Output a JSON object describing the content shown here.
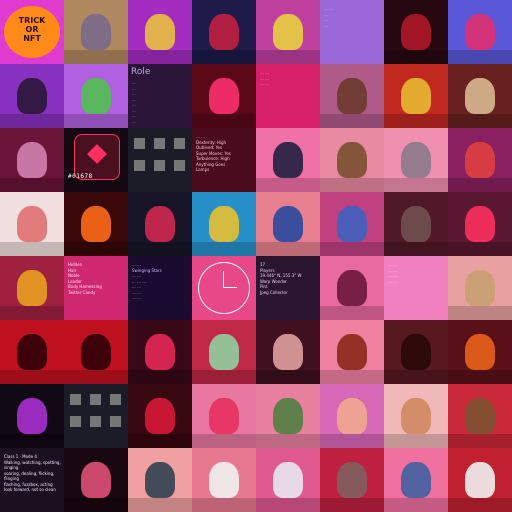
{
  "grid": {
    "rows": 8,
    "cols": 8,
    "tiles": [
      {
        "kind": "text-art",
        "bg": "#e03ad0",
        "text": "TRICK\nOR\nNFT",
        "fg": "#ff8a1a",
        "icon": "pumpkin-icon"
      },
      {
        "kind": "art",
        "bg": "#b08860",
        "fig": "#7a6a8a",
        "icon": "straw-hat-character-icon"
      },
      {
        "kind": "art",
        "bg": "#a42cc0",
        "fig": "#e8c040",
        "icon": "cat-character-icon"
      },
      {
        "kind": "art",
        "bg": "#1e1a4a",
        "fig": "#c02040",
        "icon": "demon-portrait-icon"
      },
      {
        "kind": "art",
        "bg": "#c040a0",
        "fig": "#e8d040",
        "icon": "lollipop-face-icon"
      },
      {
        "kind": "text",
        "bg": "#9a68d8",
        "text": "... ...\n...\n...\n...",
        "fg": "#e8ddff"
      },
      {
        "kind": "art",
        "bg": "#280810",
        "fig": "#b01828",
        "icon": "red-figure-icon"
      },
      {
        "kind": "art",
        "bg": "#5a58d8",
        "fig": "#e03070",
        "icon": "helmet-character-icon"
      },
      {
        "kind": "art",
        "bg": "#8830c0",
        "fig": "#2a1838",
        "icon": "bunny-character-icon"
      },
      {
        "kind": "art",
        "bg": "#b060e0",
        "fig": "#50c050",
        "icon": "green-alien-icon"
      },
      {
        "kind": "text-big",
        "bg": "#2a1438",
        "text": "Role",
        "sub": "...\n...\n...\n...\n...\n...\n...\n...",
        "fg": "#c8a8e8"
      },
      {
        "kind": "art",
        "bg": "#5a0818",
        "fig": "#ff3070",
        "icon": "neon-cat-icon"
      },
      {
        "kind": "text",
        "bg": "#d8206a",
        "text": "... ...\n... ...\n... ...",
        "fg": "#ffd0e8"
      },
      {
        "kind": "art",
        "bg": "#b05a8a",
        "fig": "#6a3a2a",
        "icon": "hooded-figure-icon"
      },
      {
        "kind": "art",
        "bg": "#c02820",
        "fig": "#e8b830",
        "icon": "gold-skull-suit-icon"
      },
      {
        "kind": "art",
        "bg": "#682020",
        "fig": "#d8b890",
        "icon": "man-with-ticket-icon"
      },
      {
        "kind": "art",
        "bg": "#6a1438",
        "fig": "#d080b0",
        "icon": "ethereum-diamond-icon"
      },
      {
        "kind": "token",
        "bg": "#160810",
        "text": "#01678",
        "fg": "#ffffff",
        "icon": "device-icon"
      },
      {
        "kind": "squares",
        "bg": "#1c1c28"
      },
      {
        "kind": "text",
        "bg": "#4a0c1c",
        "text": "... ...\nDexterity: High\nOutlined: Yes\nSuper Moves: Yes\nTurbulence: High\nAnything Goes\nLamps",
        "fg": "#f2c8d8"
      },
      {
        "kind": "art",
        "bg": "#f070a8",
        "fig": "#202040",
        "icon": "zombie-figure-icon"
      },
      {
        "kind": "art",
        "bg": "#e88aa0",
        "fig": "#7a5030",
        "icon": "scarecrow-icon"
      },
      {
        "kind": "art",
        "bg": "#f090b0",
        "fig": "#8a7a8a",
        "icon": "robot-cat-icon"
      },
      {
        "kind": "art",
        "bg": "#8a2060",
        "fig": "#e04040",
        "icon": "pixel-city-icon"
      },
      {
        "kind": "art",
        "bg": "#f2e0e0",
        "fig": "#e07070",
        "icon": "clown-face-icon"
      },
      {
        "kind": "art",
        "bg": "#3a0808",
        "fig": "#ff6a1a",
        "icon": "eclipse-woman-icon"
      },
      {
        "kind": "art",
        "bg": "#181428",
        "fig": "#d02850",
        "icon": "nebula-icon"
      },
      {
        "kind": "art",
        "bg": "#2890c8",
        "fig": "#e8c030",
        "icon": "robot-skater-icon"
      },
      {
        "kind": "art",
        "bg": "#e88090",
        "fig": "#2848a0",
        "icon": "bulldog-flag-icon"
      },
      {
        "kind": "art",
        "bg": "#c04080",
        "fig": "#4060c0",
        "icon": "pixel-noise-icon"
      },
      {
        "kind": "art",
        "bg": "#501828",
        "fig": "#705050",
        "icon": "wolf-character-icon"
      },
      {
        "kind": "art",
        "bg": "#5a1830",
        "fig": "#ff3060",
        "icon": "neon-room-icon"
      },
      {
        "kind": "art",
        "bg": "#a02040",
        "fig": "#e8a020",
        "icon": "diver-robot-icon"
      },
      {
        "kind": "text",
        "bg": "#d02870",
        "text": "Hidden\nHair\nNoble\nLeader\nBody Harnessing\nTwitter Candy",
        "fg": "#ffe0f0"
      },
      {
        "kind": "text",
        "bg": "#1a0a30",
        "text": "... ...\nSwinging Stars\n... ...\n... ... ...\n... ...\n... ...\n... ...",
        "fg": "#c8b8ff"
      },
      {
        "kind": "clock",
        "bg": "#e84888",
        "fg": "#ffffff",
        "icon": "clock-icon"
      },
      {
        "kind": "text",
        "bg": "#2a1430",
        "text": "17\nPlayers\n19.446° N, 155.3° W\nWarp Wonder\nPint\nJpeg Collector",
        "fg": "#e8d0f0"
      },
      {
        "kind": "art",
        "bg": "#e86aa0",
        "fig": "#6a1838",
        "icon": "abstract-circles-icon"
      },
      {
        "kind": "text",
        "bg": "#f080c0",
        "text": "... ...\n... ...\n... ...\n... ...",
        "fg": "#ffe8f4"
      },
      {
        "kind": "art",
        "bg": "#e8a0a0",
        "fig": "#c8a070",
        "icon": "camel-character-icon"
      },
      {
        "kind": "art",
        "bg": "#c01020",
        "fig": "#300008",
        "icon": "shadow-creature-icon"
      },
      {
        "kind": "art",
        "bg": "#c01020",
        "fig": "#300008",
        "icon": "shadow-creature-icon"
      },
      {
        "kind": "art",
        "bg": "#380818",
        "fig": "#e82858",
        "icon": "lines-field-icon"
      },
      {
        "kind": "art",
        "bg": "#c02848",
        "fig": "#90d0a0",
        "icon": "bald-alien-icon"
      },
      {
        "kind": "art",
        "bg": "#401020",
        "fig": "#e0a0a0",
        "icon": "dancer-icon"
      },
      {
        "kind": "art",
        "bg": "#f080a0",
        "fig": "#8a2818",
        "icon": "cube-character-icon"
      },
      {
        "kind": "art",
        "bg": "#581820",
        "fig": "#2a0808",
        "icon": "armadillo-icon"
      },
      {
        "kind": "art",
        "bg": "#5a1018",
        "fig": "#e86018",
        "icon": "geometric-face-icon"
      },
      {
        "kind": "art",
        "bg": "#100814",
        "fig": "#a830d0",
        "icon": "stage-lights-icon"
      },
      {
        "kind": "squares",
        "bg": "#1c1c28"
      },
      {
        "kind": "art",
        "bg": "#380810",
        "fig": "#d81838",
        "icon": "data-grid-icon"
      },
      {
        "kind": "art",
        "bg": "#e878a0",
        "fig": "#e83060",
        "icon": "cowboy-character-icon"
      },
      {
        "kind": "art",
        "bg": "#e880a0",
        "fig": "#508040",
        "icon": "skull-plant-icon"
      },
      {
        "kind": "art",
        "bg": "#d868b8",
        "fig": "#f0a890",
        "icon": "figure-painting-icon"
      },
      {
        "kind": "art",
        "bg": "#f0b8b8",
        "fig": "#d08860",
        "icon": "punk-man-icon"
      },
      {
        "kind": "art",
        "bg": "#c82838",
        "fig": "#7a5030",
        "icon": "ape-portrait-icon"
      },
      {
        "kind": "text",
        "bg": "#1a1020",
        "text": "Class 1 · Mode 4\nWalking, watching, spotting, singing\nsoaring, dealing, flicking, flinging\nflashing, fuzzbox, acting\nlook forward, not so clean",
        "fg": "#ffe0ff"
      },
      {
        "kind": "art",
        "bg": "#1a0810",
        "fig": "#e05078",
        "icon": "pink-sculpture-icon"
      },
      {
        "kind": "art",
        "bg": "#f0a0a0",
        "fig": "#304050",
        "icon": "gas-mask-icon"
      },
      {
        "kind": "art",
        "bg": "#e87890",
        "fig": "#f0f0f0",
        "icon": "raccoon-icon"
      },
      {
        "kind": "art",
        "bg": "#e05890",
        "fig": "#e8e8f0",
        "icon": "cat-hoodie-icon"
      },
      {
        "kind": "art",
        "bg": "#c02040",
        "fig": "#806060",
        "icon": "monkey-portrait-icon"
      },
      {
        "kind": "art",
        "bg": "#f070a0",
        "fig": "#4060a0",
        "icon": "rabbit-figure-icon"
      },
      {
        "kind": "art",
        "bg": "#c02030",
        "fig": "#f0f0f0",
        "icon": "bear-wine-icon"
      }
    ]
  }
}
